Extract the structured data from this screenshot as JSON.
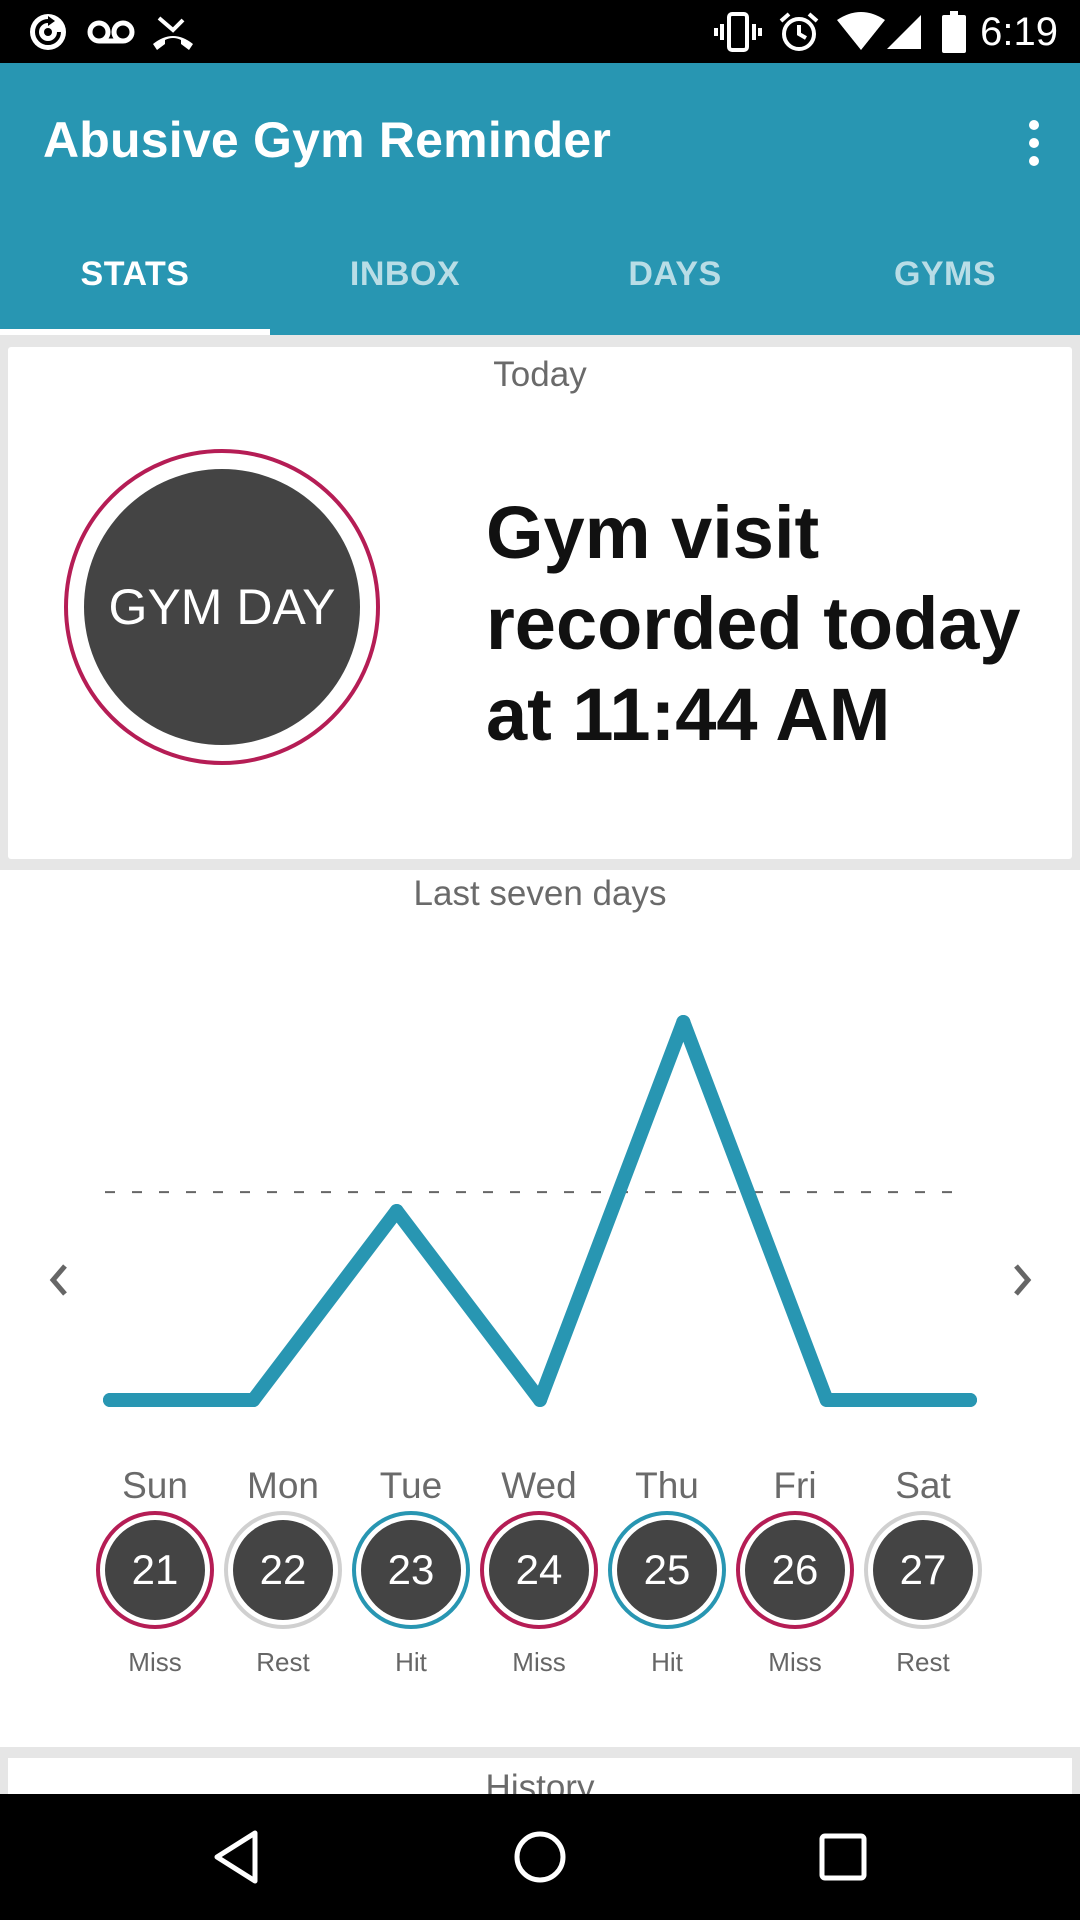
{
  "status_bar": {
    "time": "6:19",
    "left_icons": [
      "sync-icon",
      "voicemail-icon",
      "missed-call-icon"
    ],
    "right_icons": [
      "vibrate-icon",
      "alarm-icon",
      "wifi-icon",
      "signal-icon",
      "battery-icon"
    ]
  },
  "app": {
    "title": "Abusive Gym Reminder",
    "menu_icon": "overflow-menu-icon"
  },
  "tabs": [
    {
      "label": "STATS",
      "active": true
    },
    {
      "label": "INBOX",
      "active": false
    },
    {
      "label": "DAYS",
      "active": false
    },
    {
      "label": "GYMS",
      "active": false
    }
  ],
  "today": {
    "title": "Today",
    "badge": "GYM DAY",
    "message": "Gym visit recorded today at 11:44 AM",
    "badge_ring_color": "#b51d55"
  },
  "week": {
    "title": "Last seven days",
    "days": [
      {
        "name": "Sun",
        "date": "21",
        "status": "Miss"
      },
      {
        "name": "Mon",
        "date": "22",
        "status": "Rest"
      },
      {
        "name": "Tue",
        "date": "23",
        "status": "Hit"
      },
      {
        "name": "Wed",
        "date": "24",
        "status": "Miss"
      },
      {
        "name": "Thu",
        "date": "25",
        "status": "Hit"
      },
      {
        "name": "Fri",
        "date": "26",
        "status": "Miss"
      },
      {
        "name": "Sat",
        "date": "27",
        "status": "Rest"
      }
    ],
    "status_colors": {
      "Miss": "#b51d55",
      "Hit": "#2896b2",
      "Rest": "#d0d0d0"
    },
    "prev_icon": "chevron-left-icon",
    "next_icon": "chevron-right-icon"
  },
  "chart_data": {
    "type": "line",
    "x": [
      "Sun",
      "Mon",
      "Tue",
      "Wed",
      "Thu",
      "Fri",
      "Sat"
    ],
    "values": [
      0,
      0,
      0.5,
      0,
      1,
      0,
      0
    ],
    "threshold": 0.55,
    "line_color": "#2896b2",
    "grid": false
  },
  "history": {
    "title": "History"
  },
  "nav_bar": {
    "icons": [
      "back-icon",
      "home-icon",
      "recents-icon"
    ]
  }
}
